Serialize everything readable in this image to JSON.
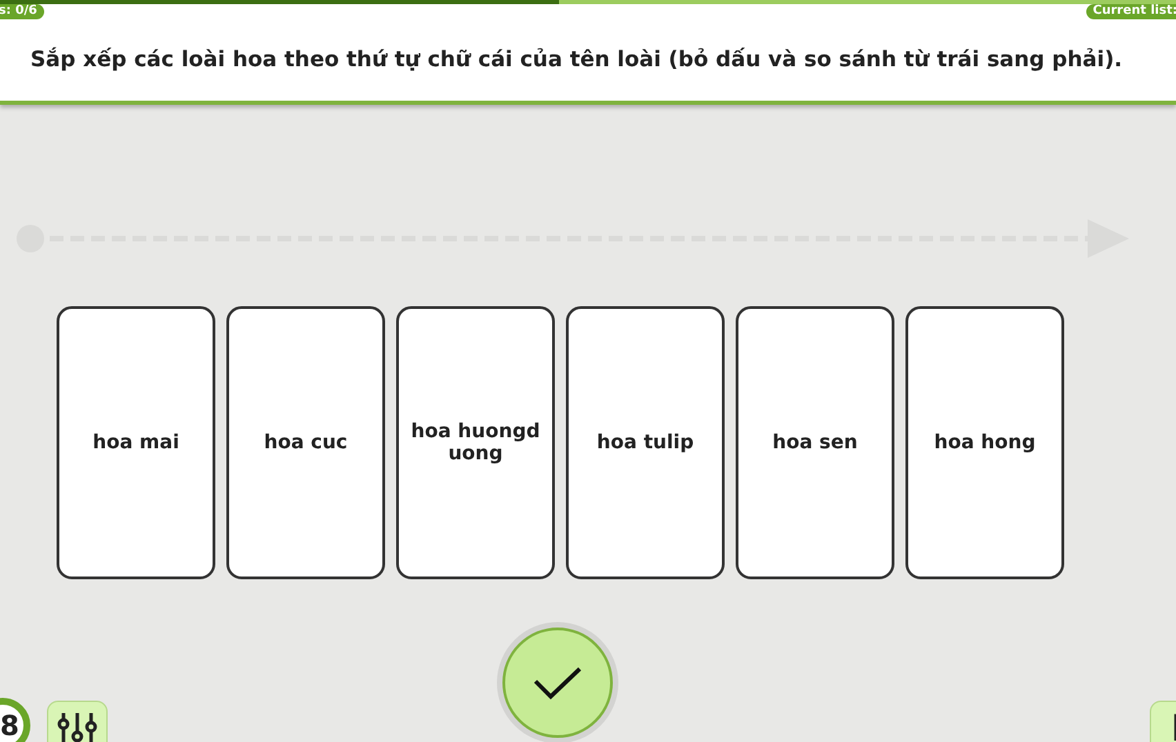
{
  "progress": {
    "level": 0.475
  },
  "score_badge": "s: 0/6",
  "list_badge": "Current list:",
  "instruction": "Sắp xếp các loài hoa theo thứ tự chữ cái của tên loài (bỏ dấu và so sánh từ trái sang phải).",
  "cards": [
    {
      "label": "hoa mai"
    },
    {
      "label": "hoa cuc"
    },
    {
      "label": "hoa huongduong"
    },
    {
      "label": "hoa tulip"
    },
    {
      "label": "hoa sen"
    },
    {
      "label": "hoa hong"
    }
  ],
  "level_number": "8"
}
